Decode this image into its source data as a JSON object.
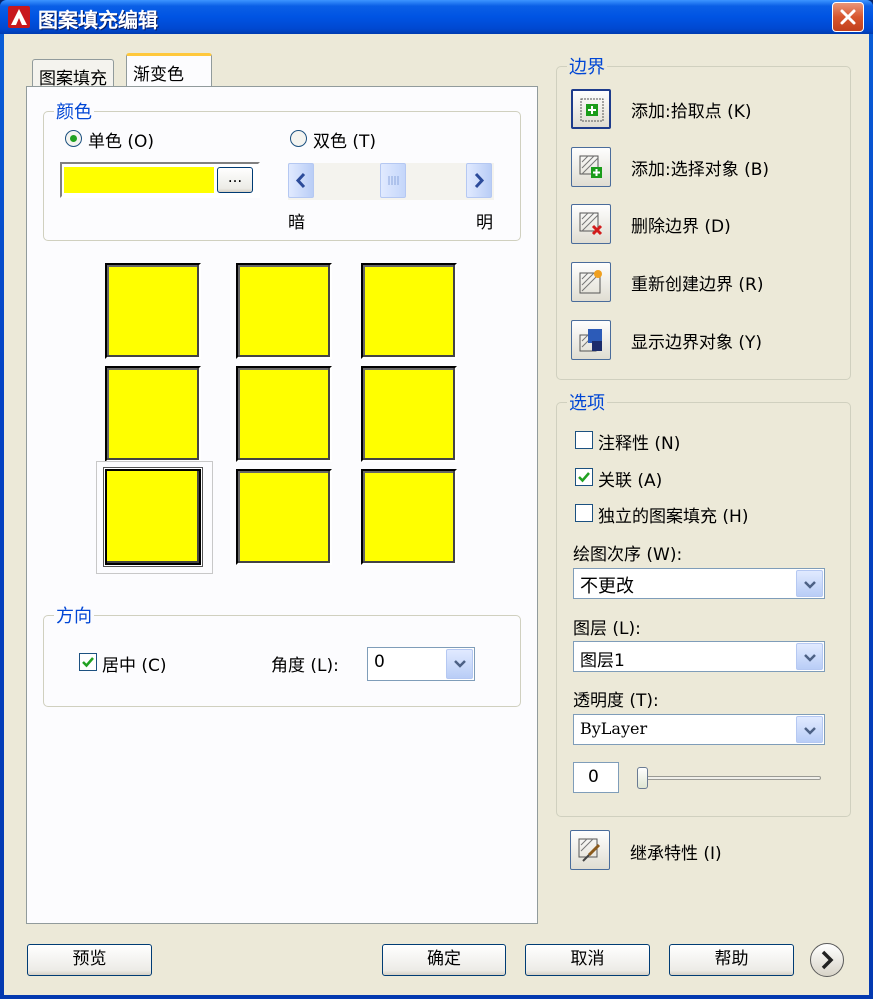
{
  "window": {
    "title": "图案填充编辑"
  },
  "tabs": [
    {
      "label": "图案填充"
    },
    {
      "label": "渐变色"
    }
  ],
  "color_group": {
    "title": "颜色",
    "single_label": "单色 (O)",
    "double_label": "双色 (T)",
    "dark_label": "暗",
    "light_label": "明",
    "browse_label": "...",
    "color": "#ffff00"
  },
  "direction_group": {
    "title": "方向",
    "center_label": "居中 (C)",
    "angle_label": "角度 (L):",
    "angle_value": "0"
  },
  "boundary_group": {
    "title": "边界",
    "add_pick_label": "添加:拾取点 (K)",
    "add_select_label": "添加:选择对象 (B)",
    "remove_label": "删除边界 (D)",
    "recreate_label": "重新创建边界 (R)",
    "show_label": "显示边界对象 (Y)"
  },
  "options_group": {
    "title": "选项",
    "annotative_label": "注释性 (N)",
    "associative_label": "关联 (A)",
    "independent_label": "独立的图案填充 (H)",
    "draw_order_label": "绘图次序 (W):",
    "draw_order_value": "不更改",
    "layer_label": "图层 (L):",
    "layer_value": "图层1",
    "transparency_label": "透明度 (T):",
    "transparency_value": "ByLayer",
    "transparency_amount": "0"
  },
  "inherit_label": "继承特性 (I)",
  "footer": {
    "preview_label": "预览",
    "ok_label": "确定",
    "cancel_label": "取消",
    "help_label": "帮助"
  }
}
